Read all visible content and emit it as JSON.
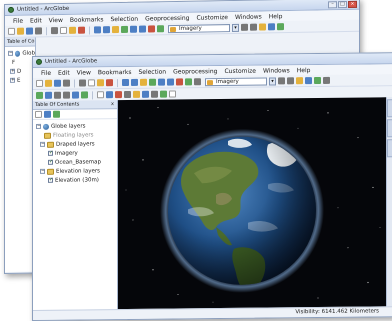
{
  "back_window": {
    "title": "Untitled - ArcGlobe",
    "menu": [
      "File",
      "Edit",
      "View",
      "Bookmarks",
      "Selection",
      "Geoprocessing",
      "Customize",
      "Windows",
      "Help"
    ],
    "imagery_combo": "Imagery",
    "toc_title": "Table of Co",
    "tree": [
      "Glob",
      "F",
      "D",
      "E"
    ]
  },
  "front_window": {
    "title": "Untitled - ArcGlobe",
    "menu": [
      "File",
      "Edit",
      "View",
      "Bookmarks",
      "Selection",
      "Geoprocessing",
      "Customize",
      "Windows",
      "Help"
    ],
    "imagery_combo": "Imagery",
    "toc_title": "Table Of Contents",
    "toc_close": "x",
    "tree": {
      "globe_layers": "Globe layers",
      "floating_layers": "Floating layers",
      "draped_layers": "Draped layers",
      "imagery": "Imagery",
      "ocean_basemap": "Ocean_Basemap",
      "elevation_layers": "Elevation layers",
      "elevation_30m": "Elevation (30m)"
    },
    "status": "Visibility:  6141.462 Kilometers"
  },
  "colors": {
    "ocean": "#1f4f86",
    "land_green": "#4b6b2c",
    "ice": "#eef3f7",
    "space": "#05060a"
  },
  "icons": [
    "app-icon",
    "new-icon",
    "open-icon",
    "save-icon",
    "print-icon",
    "cut-icon",
    "copy-icon",
    "paste-icon",
    "undo-icon",
    "redo-icon",
    "add-data-icon",
    "navigate-icon",
    "zoom-icon",
    "identify-icon",
    "globe-icon",
    "layer-icon",
    "dropdown-icon"
  ]
}
